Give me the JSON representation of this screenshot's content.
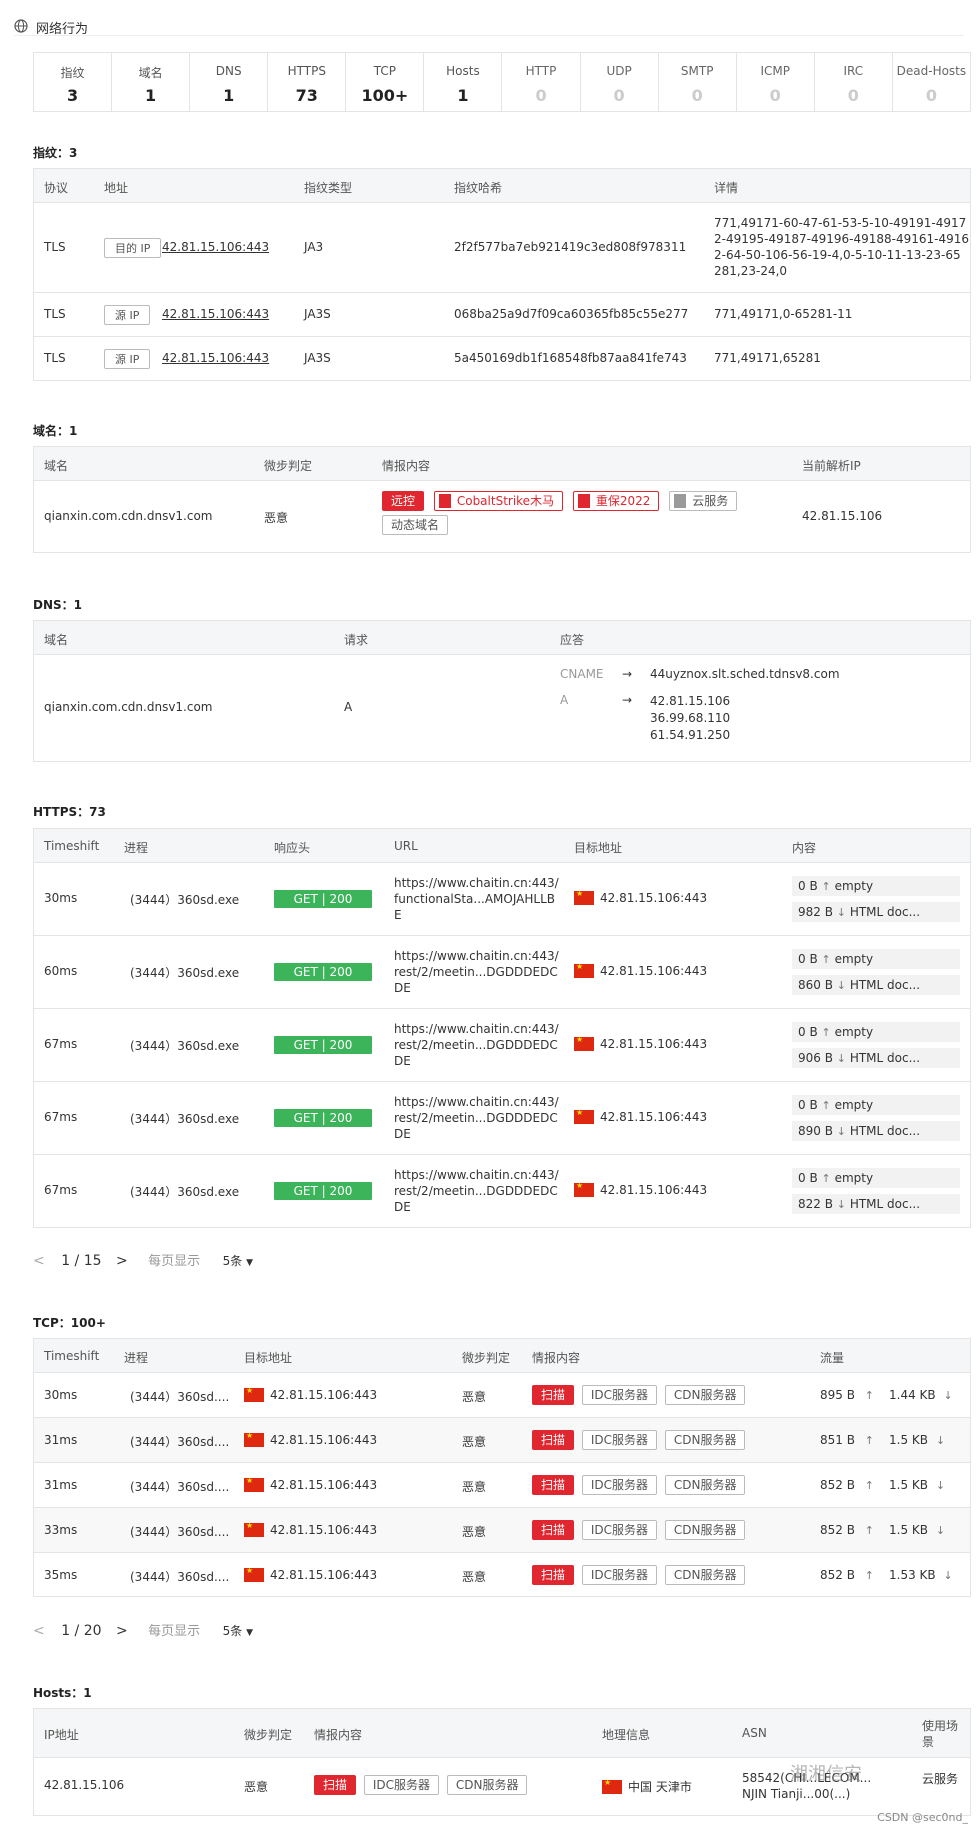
{
  "header": {
    "title": "网络行为"
  },
  "stats": [
    {
      "label": "指纹",
      "value": "3"
    },
    {
      "label": "域名",
      "value": "1"
    },
    {
      "label": "DNS",
      "value": "1"
    },
    {
      "label": "HTTPS",
      "value": "73"
    },
    {
      "label": "TCP",
      "value": "100+"
    },
    {
      "label": "Hosts",
      "value": "1"
    },
    {
      "label": "HTTP",
      "value": "0"
    },
    {
      "label": "UDP",
      "value": "0"
    },
    {
      "label": "SMTP",
      "value": "0"
    },
    {
      "label": "ICMP",
      "value": "0"
    },
    {
      "label": "IRC",
      "value": "0"
    },
    {
      "label": "Dead-Hosts",
      "value": "0"
    }
  ],
  "fingerprint": {
    "title": "指纹：3",
    "headers": [
      "协议",
      "地址",
      "指纹类型",
      "指纹哈希",
      "详情"
    ],
    "rows": [
      {
        "protocol": "TLS",
        "addr_type": "目的 IP",
        "addr": "42.81.15.106:443",
        "type": "JA3",
        "hash": "2f2f577ba7eb921419c3ed808f978311",
        "detail": [
          "771,49171-60-47-61-53-5-10-49191-4917",
          "2-49195-49187-49196-49188-49161-4916",
          "2-64-50-106-56-19-4,0-5-10-11-13-23-65",
          "281,23-24,0"
        ]
      },
      {
        "protocol": "TLS",
        "addr_type": "源 IP",
        "addr": "42.81.15.106:443",
        "type": "JA3S",
        "hash": "068ba25a9d7f09ca60365fb85c55e277",
        "detail": [
          "771,49171,0-65281-11"
        ]
      },
      {
        "protocol": "TLS",
        "addr_type": "源 IP",
        "addr": "42.81.15.106:443",
        "type": "JA3S",
        "hash": "5a450169db1f168548fb87aa841fe743",
        "detail": [
          "771,49171,65281"
        ]
      }
    ]
  },
  "domain": {
    "title": "域名：1",
    "headers": [
      "域名",
      "微步判定",
      "情报内容",
      "当前解析IP"
    ],
    "row": {
      "name": "qianxin.com.cdn.dnsv1.com",
      "verdict": "恶意",
      "tags": {
        "t1": "远控",
        "t2": "CobaltStrike木马",
        "t3": "重保2022",
        "t4": "云服务",
        "t5": "动态域名"
      },
      "ip": "42.81.15.106"
    }
  },
  "dns": {
    "title": "DNS：1",
    "headers": [
      "域名",
      "请求",
      "应答"
    ],
    "row": {
      "name": "qianxin.com.cdn.dnsv1.com",
      "request": "A",
      "cname_label": "CNAME",
      "cname": "44uyznox.slt.sched.tdnsv8.com",
      "a_label": "A",
      "a_values": [
        "42.81.15.106",
        "36.99.68.110",
        "61.54.91.250"
      ]
    }
  },
  "https": {
    "title": "HTTPS：73",
    "headers": [
      "Timeshift",
      "进程",
      "响应头",
      "URL",
      "目标地址",
      "内容"
    ],
    "rows": [
      {
        "time": "30ms",
        "proc": "(3444）360sd.exe",
        "status": "GET  |  200",
        "url": [
          "https://www.chaitin.cn:443/",
          "functionalSta...AMOJAHLLB",
          "E"
        ],
        "target": "42.81.15.106:443",
        "sent": "0 B",
        "sent_label": "empty",
        "recv": "982 B",
        "recv_label": "HTML doc..."
      },
      {
        "time": "60ms",
        "proc": "(3444）360sd.exe",
        "status": "GET  |  200",
        "url": [
          "https://www.chaitin.cn:443/",
          "rest/2/meetin...DGDDDEDC",
          "DE"
        ],
        "target": "42.81.15.106:443",
        "sent": "0 B",
        "sent_label": "empty",
        "recv": "860 B",
        "recv_label": "HTML doc..."
      },
      {
        "time": "67ms",
        "proc": "(3444）360sd.exe",
        "status": "GET  |  200",
        "url": [
          "https://www.chaitin.cn:443/",
          "rest/2/meetin...DGDDDEDC",
          "DE"
        ],
        "target": "42.81.15.106:443",
        "sent": "0 B",
        "sent_label": "empty",
        "recv": "906 B",
        "recv_label": "HTML doc..."
      },
      {
        "time": "67ms",
        "proc": "(3444）360sd.exe",
        "status": "GET  |  200",
        "url": [
          "https://www.chaitin.cn:443/",
          "rest/2/meetin...DGDDDEDC",
          "DE"
        ],
        "target": "42.81.15.106:443",
        "sent": "0 B",
        "sent_label": "empty",
        "recv": "890 B",
        "recv_label": "HTML doc..."
      },
      {
        "time": "67ms",
        "proc": "(3444）360sd.exe",
        "status": "GET  |  200",
        "url": [
          "https://www.chaitin.cn:443/",
          "rest/2/meetin...DGDDDEDC",
          "DE"
        ],
        "target": "42.81.15.106:443",
        "sent": "0 B",
        "sent_label": "empty",
        "recv": "822 B",
        "recv_label": "HTML doc..."
      }
    ],
    "pager": {
      "page": "1 / 15",
      "per_page_label": "每页显示",
      "size": "5条"
    }
  },
  "tcp": {
    "title": "TCP：100+",
    "headers": [
      "Timeshift",
      "进程",
      "目标地址",
      "微步判定",
      "情报内容",
      "流量"
    ],
    "tags": {
      "scan": "扫描",
      "idc": "IDC服务器",
      "cdn": "CDN服务器"
    },
    "rows": [
      {
        "time": "30ms",
        "proc": "(3444）360sd....",
        "target": "42.81.15.106:443",
        "verdict": "恶意",
        "up": "895 B",
        "down": "1.44 KB"
      },
      {
        "time": "31ms",
        "proc": "(3444）360sd....",
        "target": "42.81.15.106:443",
        "verdict": "恶意",
        "up": "851 B",
        "down": "1.5 KB"
      },
      {
        "time": "31ms",
        "proc": "(3444）360sd....",
        "target": "42.81.15.106:443",
        "verdict": "恶意",
        "up": "852 B",
        "down": "1.5 KB"
      },
      {
        "time": "33ms",
        "proc": "(3444）360sd....",
        "target": "42.81.15.106:443",
        "verdict": "恶意",
        "up": "852 B",
        "down": "1.5 KB"
      },
      {
        "time": "35ms",
        "proc": "(3444）360sd....",
        "target": "42.81.15.106:443",
        "verdict": "恶意",
        "up": "852 B",
        "down": "1.53 KB"
      }
    ],
    "pager": {
      "page": "1 / 20",
      "per_page_label": "每页显示",
      "size": "5条"
    }
  },
  "hosts": {
    "title": "Hosts：1",
    "headers": [
      "IP地址",
      "微步判定",
      "情报内容",
      "地理信息",
      "ASN",
      "使用场",
      "景"
    ],
    "row": {
      "ip": "42.81.15.106",
      "verdict": "恶意",
      "tags": {
        "scan": "扫描",
        "idc": "IDC服务器",
        "cdn": "CDN服务器"
      },
      "geo": "中国 天津市",
      "asn": [
        "58542(CHI...LECOM...",
        "NJIN Tianji...00(...)"
      ],
      "scene": "云服务"
    }
  },
  "watermark": {
    "text": "湘湘信安",
    "csdn": "CSDN @sec0nd_"
  },
  "colors": {
    "malicious": "#e0262f",
    "get_green": "#3cb55a",
    "header_bg": "#f5f6f7"
  }
}
